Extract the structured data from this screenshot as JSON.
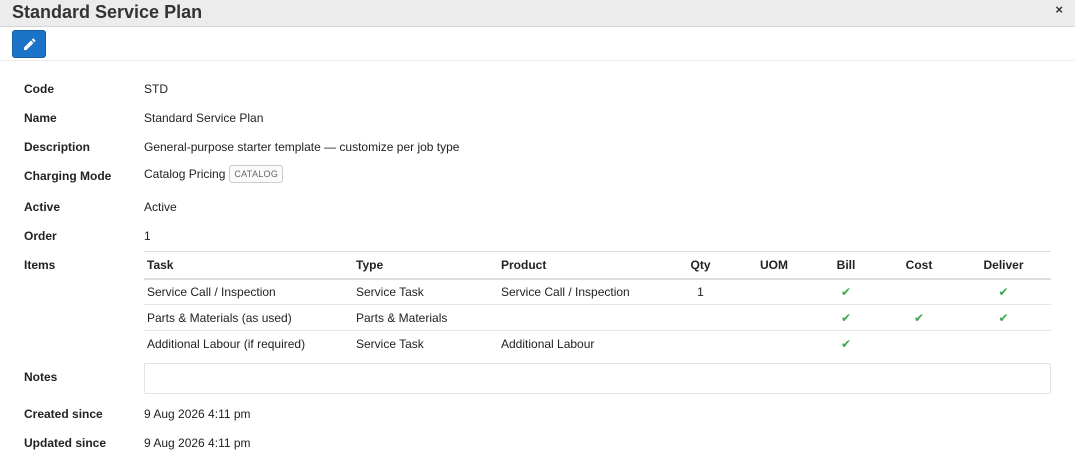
{
  "header": {
    "title": "Standard Service Plan",
    "close_icon": "×"
  },
  "toolbar": {
    "edit_icon": "pencil-icon"
  },
  "fields": {
    "code": {
      "label": "Code",
      "value": "STD"
    },
    "name": {
      "label": "Name",
      "value": "Standard Service Plan"
    },
    "description": {
      "label": "Description",
      "value": "General-purpose starter template — customize per job type"
    },
    "charging_mode": {
      "label": "Charging Mode",
      "value": "Catalog Pricing",
      "badge": "CATALOG"
    },
    "active": {
      "label": "Active",
      "value": "Active"
    },
    "order": {
      "label": "Order",
      "value": "1"
    },
    "items": {
      "label": "Items"
    },
    "notes": {
      "label": "Notes",
      "value": ""
    },
    "created": {
      "label": "Created since",
      "value": "9 Aug 2026 4:11 pm"
    },
    "updated": {
      "label": "Updated since",
      "value": "9 Aug 2026 4:11 pm"
    }
  },
  "items_table": {
    "columns": [
      "Task",
      "Type",
      "Product",
      "Qty",
      "UOM",
      "Bill",
      "Cost",
      "Deliver"
    ],
    "rows": [
      {
        "task": "Service Call / Inspection",
        "type": "Service Task",
        "product": "Service Call / Inspection",
        "qty": "1",
        "uom": "",
        "bill": "✔",
        "cost": "",
        "deliver": "✔"
      },
      {
        "task": "Parts & Materials (as used)",
        "type": "Parts & Materials",
        "product": "",
        "qty": "",
        "uom": "",
        "bill": "✔",
        "cost": "✔",
        "deliver": "✔"
      },
      {
        "task": "Additional Labour (if required)",
        "type": "Service Task",
        "product": "Additional Labour",
        "qty": "",
        "uom": "",
        "bill": "✔",
        "cost": "",
        "deliver": ""
      }
    ]
  },
  "colors": {
    "accent": "#1b73c7",
    "check": "#3aa84a",
    "header_bg": "#ececec"
  }
}
